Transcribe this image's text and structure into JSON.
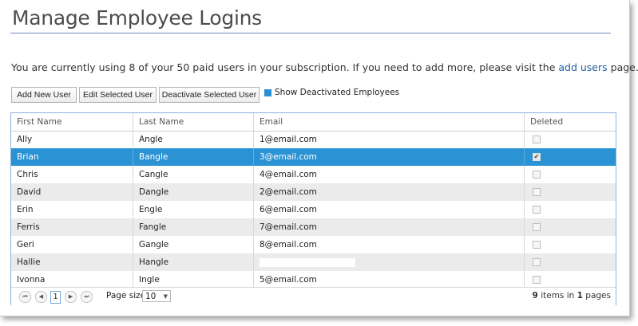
{
  "page": {
    "title": "Manage Employee Logins",
    "info_text": "You are currently using 8 of your 50 paid users in your subscription. If you need to add more, please visit the ",
    "info_link": "add users",
    "info_suffix": " page."
  },
  "toolbar": {
    "add_label": "Add New User",
    "edit_label": "Edit Selected User",
    "deactivate_label": "Deactivate Selected User",
    "show_deactivated_label": "Show Deactivated Employees",
    "show_deactivated_checked": true
  },
  "grid": {
    "columns": [
      "First Name",
      "Last Name",
      "Email",
      "Deleted"
    ],
    "rows": [
      {
        "first": "Ally",
        "last": "Angle",
        "email": "1@email.com",
        "deleted": false
      },
      {
        "first": "Brian",
        "last": "Bangle",
        "email": "3@email.com",
        "deleted": true,
        "selected": true
      },
      {
        "first": "Chris",
        "last": "Cangle",
        "email": "4@email.com",
        "deleted": false
      },
      {
        "first": "David",
        "last": "Dangle",
        "email": "2@email.com",
        "deleted": false
      },
      {
        "first": "Erin",
        "last": "Engle",
        "email": "6@email.com",
        "deleted": false
      },
      {
        "first": "Ferris",
        "last": "Fangle",
        "email": "7@email.com",
        "deleted": false
      },
      {
        "first": "Geri",
        "last": "Gangle",
        "email": "8@email.com",
        "deleted": false
      },
      {
        "first": "Hallie",
        "last": "Hangle",
        "email": "",
        "deleted": false
      },
      {
        "first": "Ivonna",
        "last": "Ingle",
        "email": "5@email.com",
        "deleted": false
      }
    ]
  },
  "pager": {
    "current_page": "1",
    "page_size_label": "Page size:",
    "page_size": "10",
    "items_count": "9",
    "items_mid": " items in ",
    "pages_count": "1",
    "pages_suffix": " pages"
  },
  "colors": {
    "selected_row": "#2b92d3",
    "alt_row": "#ebebeb",
    "link": "#1f5d9e",
    "title_rule": "#6d8fb8"
  }
}
